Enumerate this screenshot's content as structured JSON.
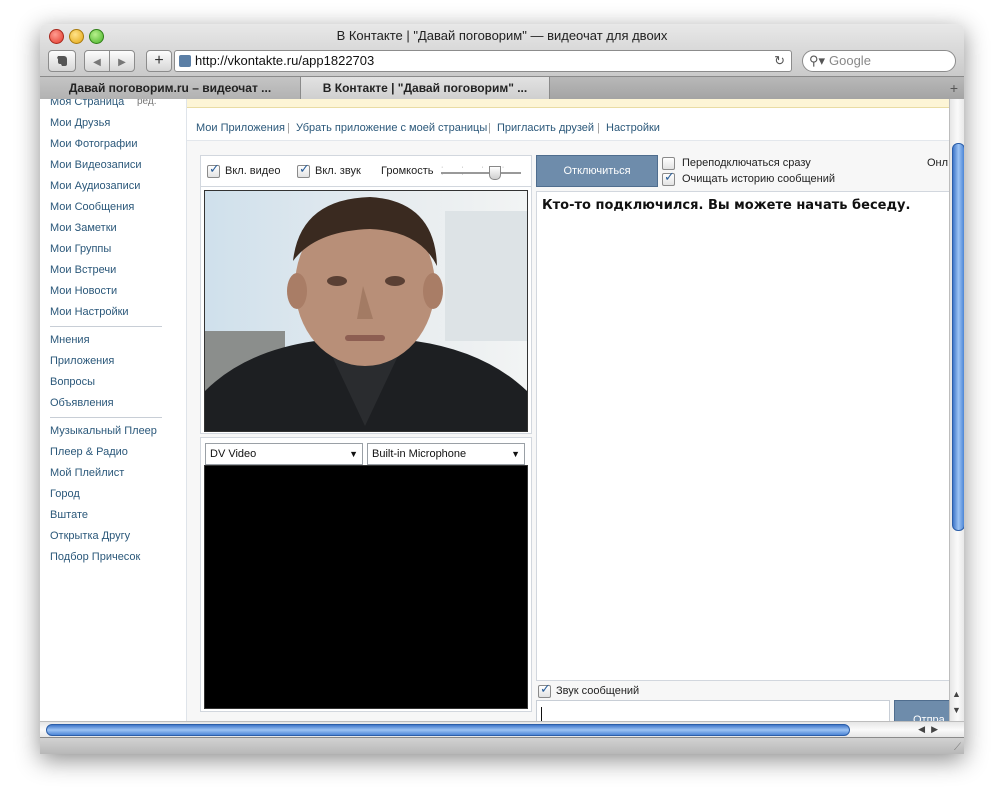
{
  "window": {
    "title": "В Контакте | \"Давай поговорим\" — видеочат для двоих"
  },
  "toolbar": {
    "evernote_icon": "elephant-icon",
    "back_glyph": "◀",
    "forward_glyph": "▶",
    "add_glyph": "+",
    "url": "http://vkontakte.ru/app1822703",
    "reload_glyph": "↻",
    "search_placeholder": "Google",
    "search_glyph": "⚲▾"
  },
  "tabs": [
    {
      "label": "Давай поговорим.ru – видеочат ..."
    },
    {
      "label": "В Контакте | \"Давай поговорим\" ..."
    }
  ],
  "tab_add_glyph": "+",
  "sidebar": {
    "edit_label": "ред.",
    "group1": [
      "Моя Страница",
      "Мои Друзья",
      "Мои Фотографии",
      "Мои Видеозаписи",
      "Мои Аудиозаписи",
      "Мои Сообщения",
      "Мои Заметки",
      "Мои Группы",
      "Мои Встречи",
      "Мои Новости",
      "Мои Настройки"
    ],
    "group2": [
      "Мнения",
      "Приложения",
      "Вопросы",
      "Объявления"
    ],
    "group3": [
      "Музыкальный Плеер",
      "Плеер & Радио",
      "Мой Плейлист",
      "Город",
      "Вштате",
      "Открытка Другу",
      "Подбор Причесок"
    ]
  },
  "app_menu": [
    "Мои Приложения",
    "Убрать приложение с моей страницы",
    "Пригласить друзей",
    "Настройки"
  ],
  "app_menu_separator": "|",
  "video_controls": {
    "video_on_label": "Вкл. видео",
    "video_on_checked": true,
    "sound_on_label": "Вкл. звук",
    "sound_on_checked": true,
    "volume_label": "Громкость",
    "volume_ticks": "· · · · · ·",
    "volume_level": 0.7
  },
  "devices": {
    "camera": "DV Video",
    "microphone": "Built-in Microphone",
    "arrow_glyph": "▼"
  },
  "chat": {
    "disconnect_label": "Отключиться",
    "reconnect_label": "Переподключаться сразу",
    "reconnect_checked": false,
    "clear_history_label": "Очищать историю сообщений",
    "clear_history_checked": true,
    "online_label": "Онл",
    "message": "Кто-то подключился. Вы можете начать беседу.",
    "sound_label": "Звук сообщений",
    "sound_checked": true,
    "send_label": "Отпра",
    "message_input_value": ""
  },
  "scrollbars": {
    "up_glyph": "▲",
    "down_glyph": "▼",
    "h_arrows": "◀▶"
  },
  "colors": {
    "link": "#2b587a",
    "button": "#6e8cab",
    "scroll_thumb": "#4d86d6"
  }
}
